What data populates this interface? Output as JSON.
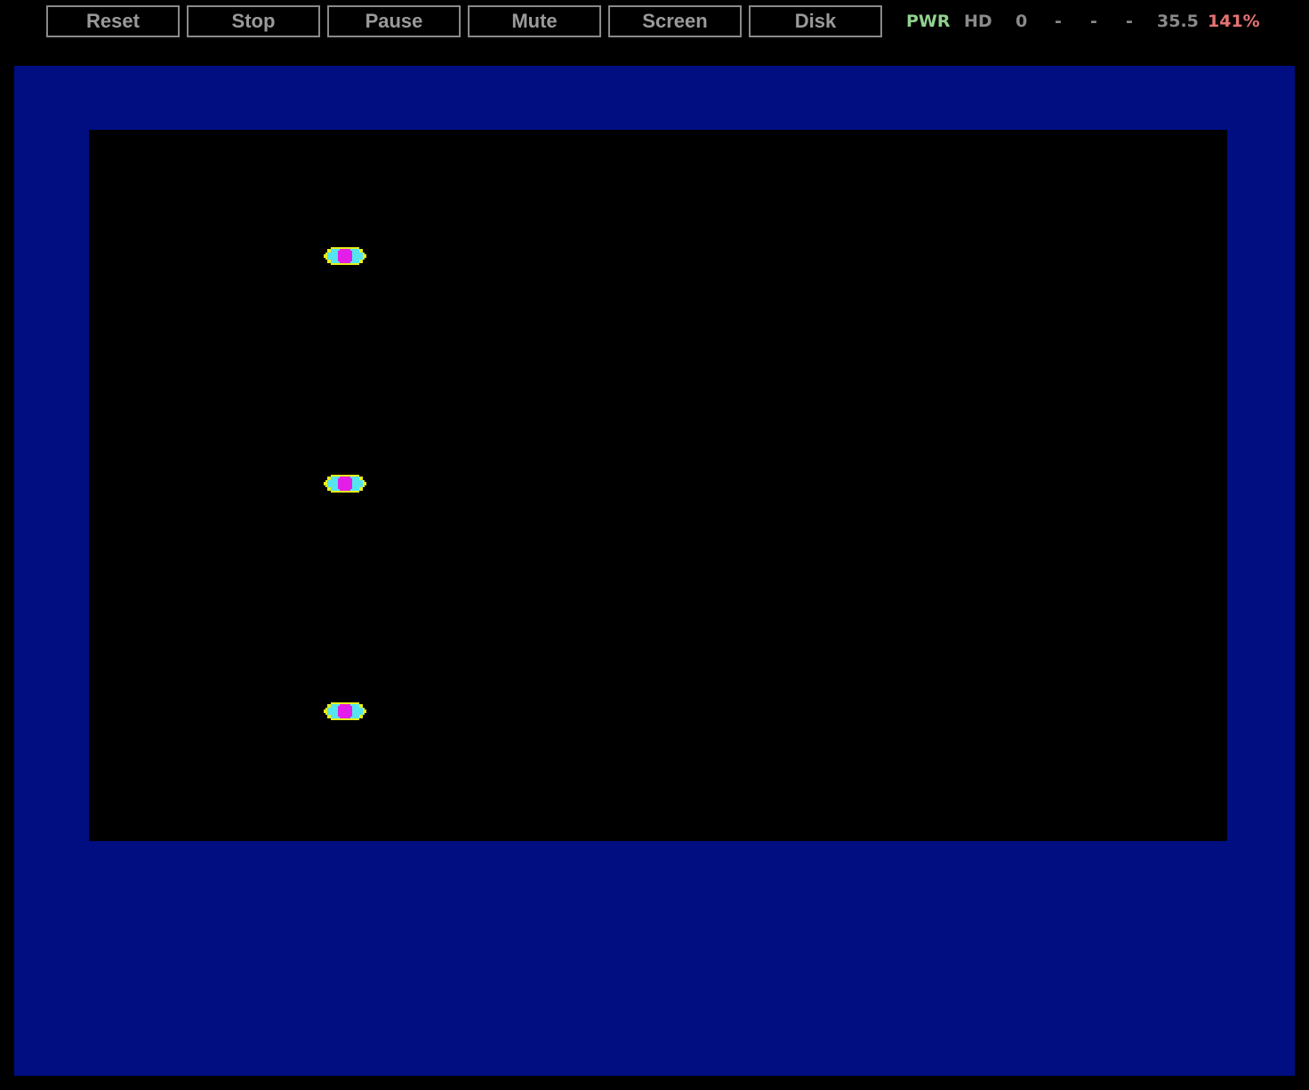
{
  "toolbar": {
    "buttons": {
      "reset": "Reset",
      "stop": "Stop",
      "pause": "Pause",
      "mute": "Mute",
      "screen": "Screen",
      "disk": "Disk"
    }
  },
  "status": {
    "pwr": "PWR",
    "hd": "HD",
    "drive0": "0",
    "drive1": "-",
    "drive2": "-",
    "drive3": "-",
    "speed": "35.5",
    "percent": "141%"
  },
  "colors": {
    "border": "#000e82",
    "screen": "#000000",
    "pwr": "#8fd18f",
    "indicator": "#8a8a8a",
    "percent": "#e57373",
    "sprite_yellow": "#e8f01a",
    "sprite_cyan": "#55e4f0",
    "sprite_magenta": "#e21ee8"
  },
  "game": {
    "sprites": [
      {
        "name": "ship-1"
      },
      {
        "name": "ship-2"
      },
      {
        "name": "ship-3"
      }
    ]
  }
}
